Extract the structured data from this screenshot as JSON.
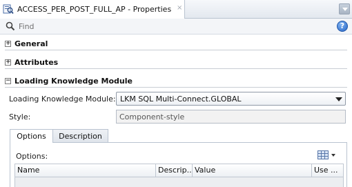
{
  "window": {
    "tab_title": "ACCESS_PER_POST_FULL_AP - Properties",
    "close_glyph": "×",
    "tab_icon": "properties-icon"
  },
  "search": {
    "placeholder": "Find",
    "help_glyph": "?"
  },
  "sections": [
    {
      "label": "General",
      "expanded": false,
      "toggle": "+"
    },
    {
      "label": "Attributes",
      "expanded": false,
      "toggle": "+"
    },
    {
      "label": "Loading Knowledge Module",
      "expanded": true,
      "toggle": "−"
    }
  ],
  "lkm": {
    "module_label": "Loading Knowledge Module:",
    "module_value": "LKM SQL Multi-Connect.GLOBAL",
    "style_label": "Style:",
    "style_placeholder": "Component-style"
  },
  "tabs": {
    "items": [
      "Options",
      "Description"
    ],
    "selected": "Options"
  },
  "options_panel": {
    "label": "Options:",
    "columns": [
      "Name",
      "Descrip...",
      "Value",
      "Use ..."
    ]
  },
  "colors": {
    "accent": "#2a68c8",
    "border": "#b9c3d0"
  }
}
